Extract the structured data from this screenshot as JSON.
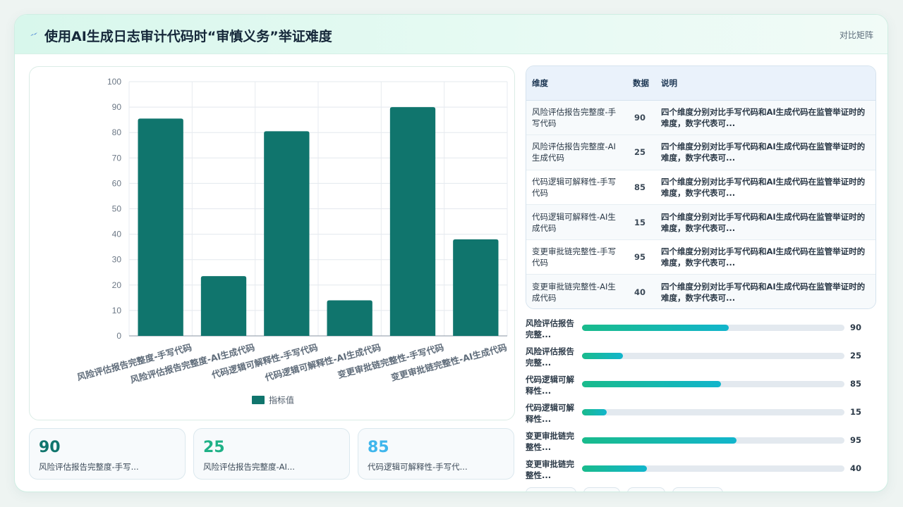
{
  "header": {
    "title": "使用AI生成日志审计代码时“审慎义务”举证难度",
    "action_label": "对比矩阵"
  },
  "colors": {
    "bar": "#10756d",
    "kpi": [
      "#10756d",
      "#1fb187",
      "#3fb6ec"
    ]
  },
  "chart_data": {
    "type": "bar",
    "categories": [
      "风险评估报告完整度-手写代码",
      "风险评估报告完整度-AI生成代码",
      "代码逻辑可解释性-手写代码",
      "代码逻辑可解释性-AI生成代码",
      "变更审批链完整性-手写代码",
      "变更审批链完整性-AI生成代码"
    ],
    "series": [
      {
        "name": "指标值",
        "values": [
          85.5,
          23.5,
          80.5,
          14,
          90,
          38
        ]
      }
    ],
    "ylim": [
      0,
      100
    ],
    "yticks": [
      0,
      10,
      20,
      30,
      40,
      50,
      60,
      70,
      80,
      90,
      100
    ],
    "grid": true,
    "legend": "bottom"
  },
  "kpis": [
    {
      "value": "90",
      "label": "风险评估报告完整度-手写..."
    },
    {
      "value": "25",
      "label": "风险评估报告完整度-AI..."
    },
    {
      "value": "85",
      "label": "代码逻辑可解释性-手写代..."
    }
  ],
  "table": {
    "headers": [
      "维度",
      "数据",
      "说明"
    ],
    "rows": [
      {
        "dim": "风险评估报告完整度-手写代码",
        "val": "90",
        "desc": "四个维度分别对比手写代码和AI生成代码在监管举证时的难度，数字代表可..."
      },
      {
        "dim": "风险评估报告完整度-AI生成代码",
        "val": "25",
        "desc": "四个维度分别对比手写代码和AI生成代码在监管举证时的难度，数字代表可..."
      },
      {
        "dim": "代码逻辑可解释性-手写代码",
        "val": "85",
        "desc": "四个维度分别对比手写代码和AI生成代码在监管举证时的难度，数字代表可..."
      },
      {
        "dim": "代码逻辑可解释性-AI生成代码",
        "val": "15",
        "desc": "四个维度分别对比手写代码和AI生成代码在监管举证时的难度，数字代表可..."
      },
      {
        "dim": "变更审批链完整性-手写代码",
        "val": "95",
        "desc": "四个维度分别对比手写代码和AI生成代码在监管举证时的难度，数字代表可..."
      },
      {
        "dim": "变更审批链完整性-AI生成代码",
        "val": "40",
        "desc": "四个维度分别对比手写代码和AI生成代码在监管举证时的难度，数字代表可..."
      }
    ]
  },
  "progress": [
    {
      "label": "风险评估报告完整...",
      "value": "90",
      "fraction": 0.56
    },
    {
      "label": "风险评估报告完整...",
      "value": "25",
      "fraction": 0.155
    },
    {
      "label": "代码逻辑可解释性...",
      "value": "85",
      "fraction": 0.53
    },
    {
      "label": "代码逻辑可解释性...",
      "value": "15",
      "fraction": 0.093
    },
    {
      "label": "变更审批链完整性...",
      "value": "95",
      "fraction": 0.59
    },
    {
      "label": "变更审批链完整性...",
      "value": "40",
      "fraction": 0.248
    }
  ]
}
